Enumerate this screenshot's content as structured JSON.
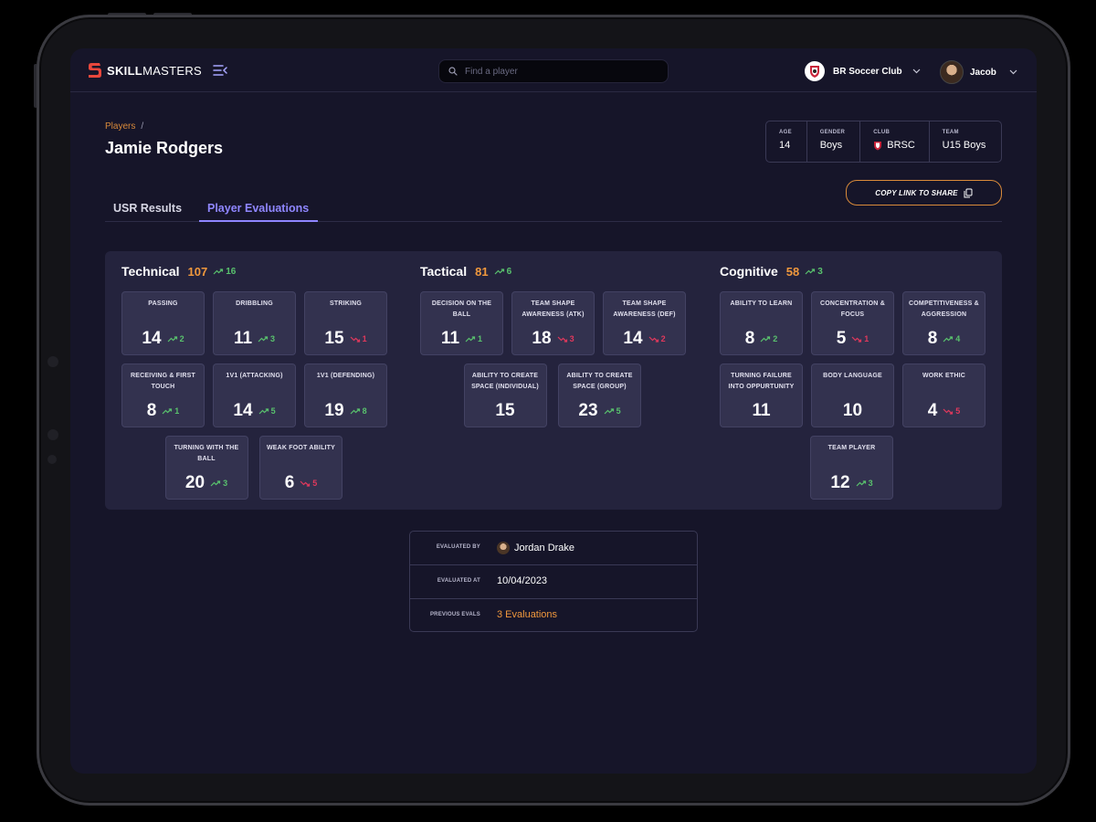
{
  "app": {
    "brand_bold": "SKILL",
    "brand_light": "MASTERS"
  },
  "search": {
    "placeholder": "Find a player"
  },
  "club": {
    "name": "BR Soccer Club"
  },
  "user": {
    "name": "Jacob"
  },
  "breadcrumb": {
    "parent": "Players",
    "separator": "/"
  },
  "player": {
    "name": "Jamie Rodgers"
  },
  "info": [
    {
      "label": "AGE",
      "value": "14"
    },
    {
      "label": "GENDER",
      "value": "Boys"
    },
    {
      "label": "CLUB",
      "value": "BRSC"
    },
    {
      "label": "TEAM",
      "value": "U15 Boys"
    }
  ],
  "copy_link_label": "COPY LINK TO SHARE",
  "tabs": [
    {
      "label": "USR Results"
    },
    {
      "label": "Player Evaluations"
    }
  ],
  "active_tab": "Player Evaluations",
  "categories": [
    {
      "name": "Technical",
      "score": "107",
      "trend": {
        "dir": "up",
        "value": "16"
      },
      "skills": [
        {
          "label": "PASSING",
          "value": "14",
          "trend": {
            "dir": "up",
            "value": "2"
          }
        },
        {
          "label": "DRIBBLING",
          "value": "11",
          "trend": {
            "dir": "up",
            "value": "3"
          }
        },
        {
          "label": "STRIKING",
          "value": "15",
          "trend": {
            "dir": "down",
            "value": "1"
          }
        },
        {
          "label": "RECEIVING & FIRST TOUCH",
          "value": "8",
          "trend": {
            "dir": "up",
            "value": "1"
          }
        },
        {
          "label": "1V1 (ATTACKING)",
          "value": "14",
          "trend": {
            "dir": "up",
            "value": "5"
          }
        },
        {
          "label": "1V1 (DEFENDING)",
          "value": "19",
          "trend": {
            "dir": "up",
            "value": "8"
          }
        },
        {
          "label": "TURNING WITH THE BALL",
          "value": "20",
          "trend": {
            "dir": "up",
            "value": "3"
          }
        },
        {
          "label": "WEAK FOOT ABILITY",
          "value": "6",
          "trend": {
            "dir": "down",
            "value": "5"
          }
        }
      ]
    },
    {
      "name": "Tactical",
      "score": "81",
      "trend": {
        "dir": "up",
        "value": "6"
      },
      "skills": [
        {
          "label": "DECISION ON THE BALL",
          "value": "11",
          "trend": {
            "dir": "up",
            "value": "1"
          }
        },
        {
          "label": "TEAM SHAPE AWARENESS (ATK)",
          "value": "18",
          "trend": {
            "dir": "down",
            "value": "3"
          }
        },
        {
          "label": "TEAM SHAPE AWARENESS (DEF)",
          "value": "14",
          "trend": {
            "dir": "down",
            "value": "2"
          }
        },
        {
          "label": "ABILITY TO CREATE SPACE (INDIVIDUAL)",
          "value": "15",
          "trend": null
        },
        {
          "label": "ABILITY TO CREATE SPACE (GROUP)",
          "value": "23",
          "trend": {
            "dir": "up",
            "value": "5"
          }
        }
      ]
    },
    {
      "name": "Cognitive",
      "score": "58",
      "trend": {
        "dir": "up",
        "value": "3"
      },
      "skills": [
        {
          "label": "ABILITY TO LEARN",
          "value": "8",
          "trend": {
            "dir": "up",
            "value": "2"
          }
        },
        {
          "label": "CONCENTRATION & FOCUS",
          "value": "5",
          "trend": {
            "dir": "down",
            "value": "1"
          }
        },
        {
          "label": "COMPETITIVENESS & AGGRESSION",
          "value": "8",
          "trend": {
            "dir": "up",
            "value": "4"
          }
        },
        {
          "label": "TURNING FAILURE INTO OPPURTUNITY",
          "value": "11",
          "trend": null
        },
        {
          "label": "BODY LANGUAGE",
          "value": "10",
          "trend": null
        },
        {
          "label": "WORK ETHIC",
          "value": "4",
          "trend": {
            "dir": "down",
            "value": "5"
          }
        },
        {
          "label": "TEAM PLAYER",
          "value": "12",
          "trend": {
            "dir": "up",
            "value": "3"
          }
        }
      ]
    }
  ],
  "evaluation": {
    "evaluated_by_label": "EVALUATED BY",
    "evaluated_by": "Jordan Drake",
    "evaluated_at_label": "EVALUATED AT",
    "evaluated_at": "10/04/2023",
    "previous_label": "PREVIOUS EVALS",
    "previous": "3 Evaluations"
  },
  "colors": {
    "accent": "#f0983d",
    "tab_active": "#8f86ff",
    "up": "#59c26d",
    "down": "#e0385c",
    "brand": "#e8473c"
  }
}
